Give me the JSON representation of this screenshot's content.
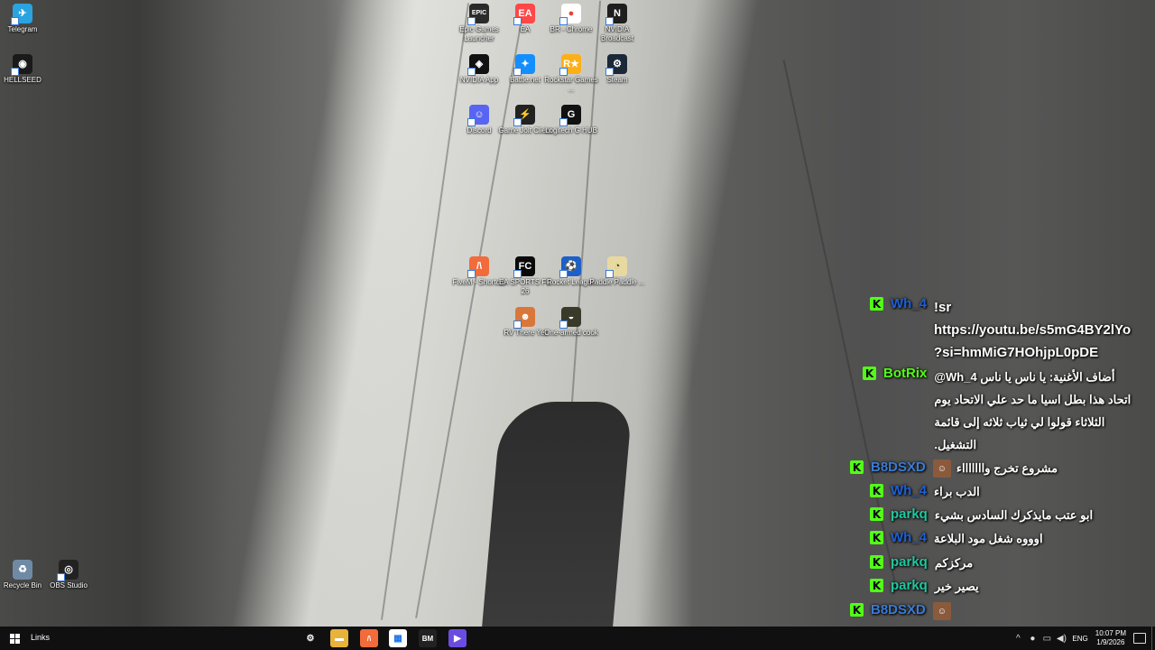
{
  "desktop": {
    "icons": [
      {
        "id": "telegram",
        "label": "Telegram",
        "icon": "telegram-icon",
        "color": "#2aa3df",
        "glyph": "✈"
      },
      {
        "id": "hellseed",
        "label": "HELLSEED",
        "icon": "hellseed-icon",
        "color": "#1a1a1a",
        "glyph": "◉"
      },
      {
        "id": "epic",
        "label": "Epic Games Launcher",
        "icon": "epic-games-icon",
        "color": "#2b2b2b",
        "glyph": "EPIC"
      },
      {
        "id": "ea",
        "label": "EA",
        "icon": "ea-icon",
        "color": "#ff4747",
        "glyph": "EA"
      },
      {
        "id": "chrome",
        "label": "BR - Chrome",
        "icon": "chrome-icon",
        "color": "#ffffff",
        "glyph": "●"
      },
      {
        "id": "nvbroadcast",
        "label": "NVIDIA Broadcast",
        "icon": "nvidia-broadcast-icon",
        "color": "#1e1e1e",
        "glyph": "N"
      },
      {
        "id": "nvapp",
        "label": "NVIDIA App",
        "icon": "nvidia-app-icon",
        "color": "#111111",
        "glyph": "◈"
      },
      {
        "id": "battlenet",
        "label": "Battle.net",
        "icon": "battlenet-icon",
        "color": "#148eff",
        "glyph": "✦"
      },
      {
        "id": "rockstar",
        "label": "Rockstar Games ...",
        "icon": "rockstar-icon",
        "color": "#fcaf17",
        "glyph": "R★"
      },
      {
        "id": "steam",
        "label": "Steam",
        "icon": "steam-icon",
        "color": "#1b2838",
        "glyph": "⚙"
      },
      {
        "id": "discord",
        "label": "Discord",
        "icon": "discord-icon",
        "color": "#5865f2",
        "glyph": "☺"
      },
      {
        "id": "gamejolt",
        "label": "Game Jolt Client",
        "icon": "gamejolt-icon",
        "color": "#222222",
        "glyph": "⚡"
      },
      {
        "id": "logitech",
        "label": "Logitech G HUB",
        "icon": "logitech-icon",
        "color": "#111111",
        "glyph": "G"
      },
      {
        "id": "fivem",
        "label": "FiveM - Shortcut",
        "icon": "fivem-icon",
        "color": "#f26b3a",
        "glyph": "/\\"
      },
      {
        "id": "eafc",
        "label": "EA SPORTS FC 26",
        "icon": "ea-fc-icon",
        "color": "#0a0a0a",
        "glyph": "FC"
      },
      {
        "id": "rocketleague",
        "label": "Rocket League",
        "icon": "rocket-league-icon",
        "color": "#1d5fc8",
        "glyph": "⚽"
      },
      {
        "id": "paddle",
        "label": "Paddle Paddle ...",
        "icon": "paddle-icon",
        "color": "#e8d9a0",
        "glyph": "◔"
      },
      {
        "id": "rvthere",
        "label": "RV There Yet",
        "icon": "rv-there-yet-icon",
        "color": "#d9773a",
        "glyph": "☻"
      },
      {
        "id": "onearmed",
        "label": "One-armed cook",
        "icon": "one-armed-cook-icon",
        "color": "#3a3a2a",
        "glyph": "◒"
      },
      {
        "id": "recycle",
        "label": "Recycle Bin",
        "icon": "recycle-bin-icon",
        "color": "#6f8aa5",
        "glyph": "♻"
      },
      {
        "id": "obs",
        "label": "OBS Studio",
        "icon": "obs-icon",
        "color": "#222222",
        "glyph": "◎"
      }
    ]
  },
  "chat": {
    "badge_glyph": "K",
    "badge_color": "#53fc18",
    "messages": [
      {
        "user": "Wh_4",
        "user_color": "#1e5fd6",
        "lines": [
          "!sr",
          "https://youtu.be/s5mG4BY2lYo",
          "?si=hmMiG7HOhjpL0pDE"
        ]
      },
      {
        "user": "BotRix",
        "user_color": "#53fc18",
        "lines": [
          "أضاف الأغنية: يا ناس يا ناس Wh_4@",
          "اتحاد هذا بطل اسيا ما حد علي الاتحاد يوم",
          "الثلاثاء قولوا لي ثياب ثلاثه إلى قائمة",
          "التشغيل."
        ]
      },
      {
        "user": "B8DSXD",
        "user_color": "#3a7bd5",
        "lines": [
          "مشروع تخرج واااااااء"
        ]
      },
      {
        "user": "Wh_4",
        "user_color": "#1e5fd6",
        "lines": [
          "الدب براء"
        ]
      },
      {
        "user": "parkq",
        "user_color": "#1fc8a0",
        "lines": [
          "ابو عتب مايذكرك السادس بشيء"
        ]
      },
      {
        "user": "Wh_4",
        "user_color": "#1e5fd6",
        "lines": [
          "اوووه شغل مود البلاعة"
        ]
      },
      {
        "user": "parkq",
        "user_color": "#1fc8a0",
        "lines": [
          "مركزكم"
        ]
      },
      {
        "user": "parkq",
        "user_color": "#1fc8a0",
        "lines": [
          "يصير خير"
        ]
      },
      {
        "user": "B8DSXD",
        "user_color": "#3a7bd5",
        "lines": [
          ""
        ]
      }
    ]
  },
  "taskbar": {
    "toolbar_label": "Links",
    "apps": [
      {
        "name": "settings-icon",
        "glyph": "⚙",
        "color": "#101010"
      },
      {
        "name": "file-explorer-icon",
        "glyph": "▬",
        "color": "#e8b33a"
      },
      {
        "name": "fivem-taskbar-icon",
        "glyph": "/\\",
        "color": "#f26b3a"
      },
      {
        "name": "microsoft-store-icon",
        "glyph": "▦",
        "color": "#ffffff"
      },
      {
        "name": "bm-app-icon",
        "glyph": "BM",
        "color": "#222222"
      },
      {
        "name": "media-player-icon",
        "glyph": "▶",
        "color": "#6a4de0"
      }
    ],
    "tray": {
      "chevron": "^",
      "mic": "🎤",
      "network": "▭",
      "volume": "🔊",
      "language": "ENG",
      "time": "10:07 PM",
      "date": "1/9/2026"
    }
  }
}
